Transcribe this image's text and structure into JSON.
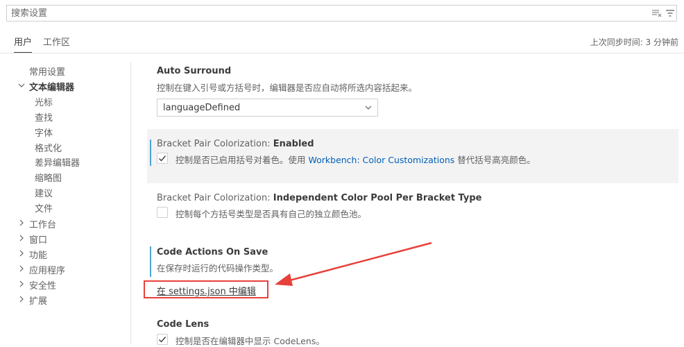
{
  "search": {
    "placeholder": "搜索设置"
  },
  "tabs": [
    {
      "label": "用户"
    },
    {
      "label": "工作区"
    }
  ],
  "sync_status": "上次同步时间: 3 分钟前",
  "toc": [
    {
      "label": "常用设置"
    },
    {
      "label": "文本编辑器"
    },
    {
      "label": "光标"
    },
    {
      "label": "查找"
    },
    {
      "label": "字体"
    },
    {
      "label": "格式化"
    },
    {
      "label": "差异编辑器"
    },
    {
      "label": "缩略图"
    },
    {
      "label": "建议"
    },
    {
      "label": "文件"
    },
    {
      "label": "工作台"
    },
    {
      "label": "窗口"
    },
    {
      "label": "功能"
    },
    {
      "label": "应用程序"
    },
    {
      "label": "安全性"
    },
    {
      "label": "扩展"
    }
  ],
  "settings": {
    "auto_surround": {
      "title": "Auto Surround",
      "description": "控制在键入引号或方括号时，编辑器是否应自动将所选内容括起来。",
      "value": "languageDefined"
    },
    "bracket_enabled": {
      "category": "Bracket Pair Colorization: ",
      "name": "Enabled",
      "desc_before": "控制是否已启用括号对着色。使用 ",
      "link": "Workbench: Color Customizations",
      "desc_after": " 替代括号高亮颜色。"
    },
    "bracket_pool": {
      "category": "Bracket Pair Colorization: ",
      "name": "Independent Color Pool Per Bracket Type",
      "description": "控制每个方括号类型是否具有自己的独立颜色池。"
    },
    "code_actions": {
      "title": "Code Actions On Save",
      "description": "在保存时运行的代码操作类型。",
      "edit_link": "在 settings.json 中编辑"
    },
    "code_lens": {
      "title": "Code Lens",
      "description": "控制是否在编辑器中显示 CodeLens。"
    }
  },
  "colors": {
    "accent": "#005fb8",
    "annotation": "#e8403a",
    "modified_bar": "#4ea3d3"
  },
  "icons": [
    "clear-filter-icon",
    "filter-icon",
    "chevron-down-icon",
    "chevron-right-icon",
    "check-icon"
  ]
}
